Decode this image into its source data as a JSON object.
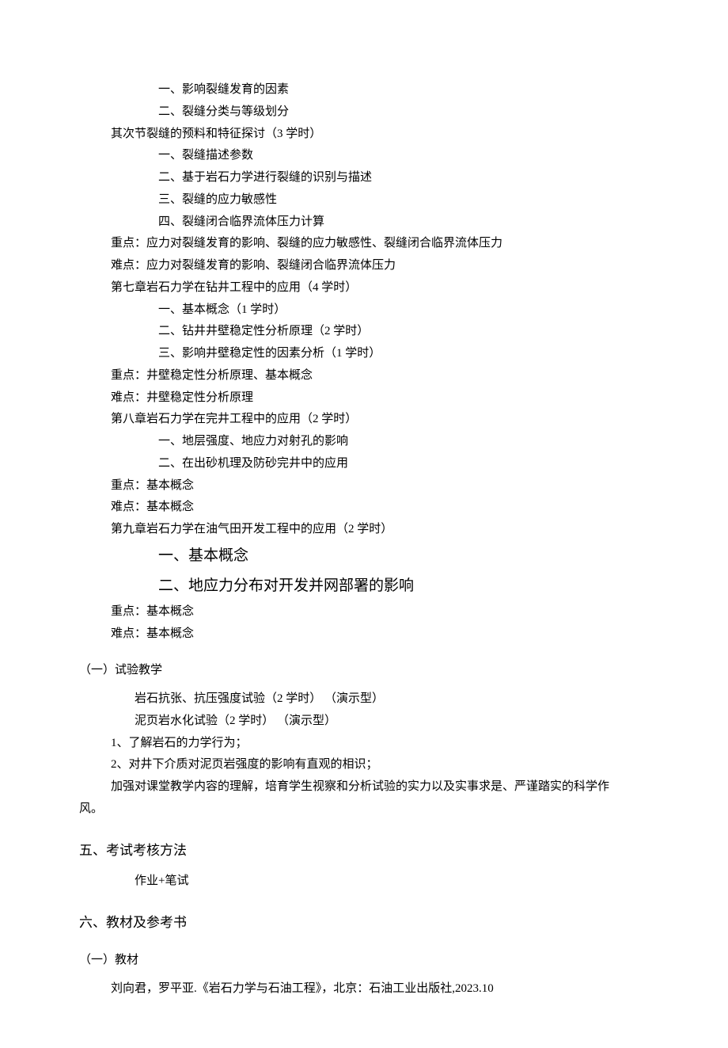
{
  "lines": {
    "l1": "一、影响裂缝发育的因素",
    "l2": "二、裂缝分类与等级划分",
    "l3": "其次节裂缝的预料和特征探讨（3 学时）",
    "l4": "一、裂缝描述参数",
    "l5": "二、基于岩石力学进行裂缝的识别与描述",
    "l6": "三、裂缝的应力敏感性",
    "l7": "四、裂缝闭合临界流体压力计算",
    "l8": "重点：应力对裂缝发育的影响、裂缝的应力敏感性、裂缝闭合临界流体压力",
    "l9": "难点：应力对裂缝发育的影响、裂缝闭合临界流体压力",
    "l10": "第七章岩石力学在钻井工程中的应用（4 学时）",
    "l11": "一、基本概念（1 学时）",
    "l12": "二、钻井井壁稳定性分析原理（2 学时）",
    "l13": "三、影响井壁稳定性的因素分析（1 学时）",
    "l14": "重点：井壁稳定性分析原理、基本概念",
    "l15": "难点：井壁稳定性分析原理",
    "l16": "第八章岩石力学在完井工程中的应用（2 学时）",
    "l17": "一、地层强度、地应力对射孔的影响",
    "l18": "二、在出砂机理及防砂完井中的应用",
    "l19": "重点：基本概念",
    "l20": "难点：基本概念",
    "l21": "第九章岩石力学在油气田开发工程中的应用（2 学时）",
    "l22": "一、基本概念",
    "l23": "二、地应力分布对开发并网部署的影响",
    "l24": "重点：基本概念",
    "l25": "难点：基本概念"
  },
  "sec1": {
    "heading_paren": "（一）",
    "heading_text": "试验教学",
    "e1": "岩石抗张、抗压强度试验（2 学时）   （演示型）",
    "e2": "泥页岩水化试验（2 学时）   （演示型）",
    "p1": "1、了解岩石的力学行为；",
    "p2": "2、对井下介质对泥页岩强度的影响有直观的相识；",
    "p3a": "加强对课堂教学内容的理解，培育学生视察和分析试验的实力以及实事求是、严谨踏实的科学作",
    "p3b": "风。"
  },
  "sec2": {
    "heading": "五、考试考核方法",
    "body": "作业+笔试"
  },
  "sec3": {
    "heading": "六、教材及参考书",
    "sub_paren": "（一）",
    "sub_text": "教材",
    "ref": "刘向君，罗平亚.《岩石力学与石油工程》，北京：石油工业出版社,2023.10"
  }
}
